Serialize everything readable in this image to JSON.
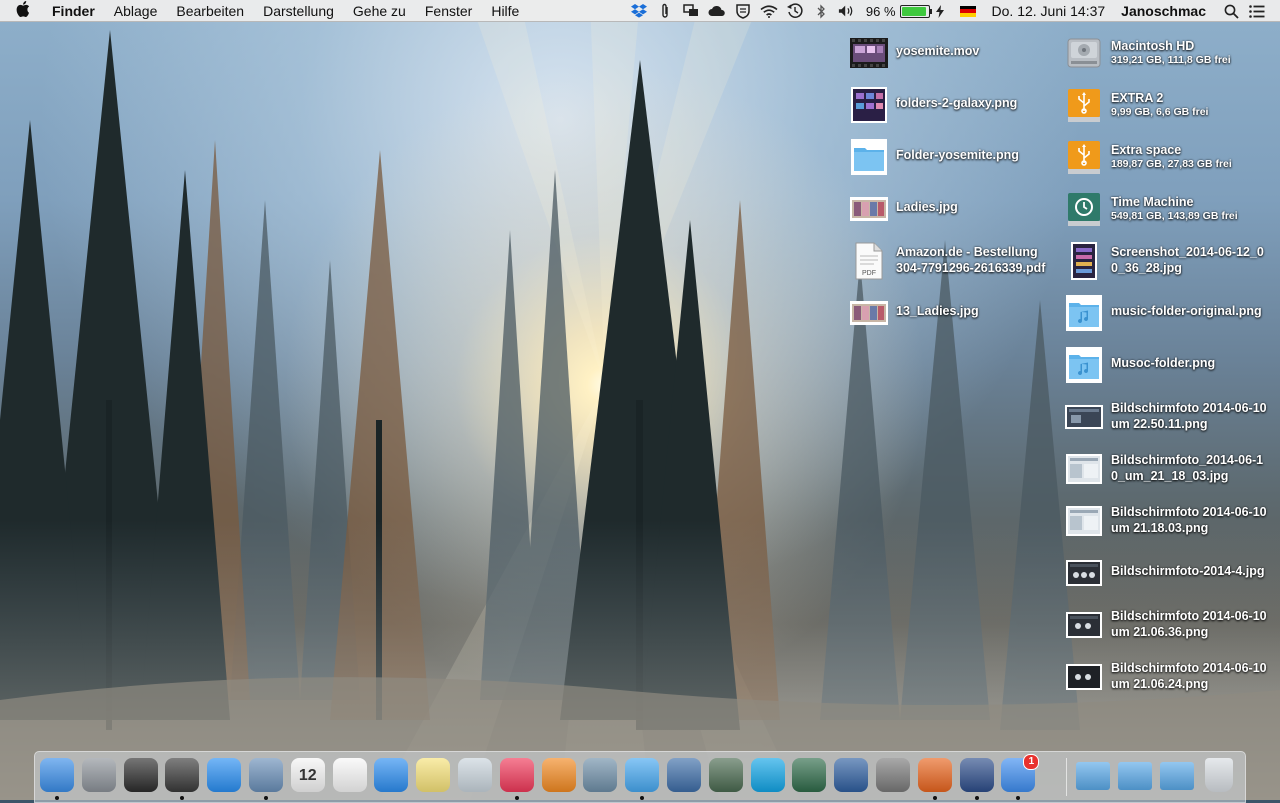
{
  "menubar": {
    "app_name": "Finder",
    "menus": [
      "Ablage",
      "Bearbeiten",
      "Darstellung",
      "Gehe zu",
      "Fenster",
      "Hilfe"
    ],
    "battery_percent": "96 %",
    "battery_level": 0.96,
    "clock": "Do. 12. Juni  14:37",
    "username": "Janoschmac"
  },
  "desktop_left": [
    {
      "name": "yosemite.mov",
      "icon": "movie-thumbnail-icon"
    },
    {
      "name": "folders-2-galaxy.png",
      "icon": "image-thumbnail-icon"
    },
    {
      "name": "Folder-yosemite.png",
      "icon": "folder-icon"
    },
    {
      "name": "Ladies.jpg",
      "icon": "image-thumbnail-icon"
    },
    {
      "name": "Amazon.de - Bestellung",
      "sub": "304-7791296-2616339.pdf",
      "icon": "pdf-document-icon"
    },
    {
      "name": "13_Ladies.jpg",
      "icon": "image-thumbnail-icon"
    }
  ],
  "desktop_right": [
    {
      "name": "Macintosh HD",
      "sub": "319,21 GB, 111,8 GB frei",
      "icon": "hard-drive-icon"
    },
    {
      "name": "EXTRA 2",
      "sub": "9,99 GB, 6,6 GB frei",
      "icon": "usb-drive-icon"
    },
    {
      "name": "Extra space",
      "sub": "189,87 GB, 27,83 GB frei",
      "icon": "usb-drive-icon"
    },
    {
      "name": "Time Machine",
      "sub": "549,81 GB, 143,89 GB frei",
      "icon": "time-machine-drive-icon"
    },
    {
      "name": "Screenshot_2014-06-12_0",
      "sub2": "0_36_28.jpg",
      "icon": "image-thumbnail-icon"
    },
    {
      "name": "music-folder-original.png",
      "icon": "music-folder-icon"
    },
    {
      "name": "Musoc-folder.png",
      "icon": "music-folder-icon"
    },
    {
      "name": "Bildschirmfoto 2014-06-10",
      "sub2": "um 22.50.11.png",
      "icon": "screenshot-thumbnail-icon"
    },
    {
      "name": "Bildschirmfoto_2014-06-1",
      "sub2": "0_um_21_18_03.jpg",
      "icon": "screenshot-thumbnail-icon"
    },
    {
      "name": "Bildschirmfoto 2014-06-10",
      "sub2": "um 21.18.03.png",
      "icon": "screenshot-thumbnail-icon"
    },
    {
      "name": "Bildschirmfoto-2014-4.jpg",
      "icon": "screenshot-thumbnail-icon"
    },
    {
      "name": "Bildschirmfoto 2014-06-10",
      "sub2": "um 21.06.36.png",
      "icon": "screenshot-thumbnail-icon"
    },
    {
      "name": "Bildschirmfoto 2014-06-10",
      "sub2": "um 21.06.24.png",
      "icon": "screenshot-thumbnail-icon"
    }
  ],
  "dock": {
    "apps": [
      {
        "icon": "finder-icon",
        "color": "#3b8ee8",
        "running": true
      },
      {
        "icon": "launchpad-icon",
        "color": "#8c9299",
        "running": false
      },
      {
        "icon": "mission-control-icon",
        "color": "#2c2c2c",
        "running": false
      },
      {
        "icon": "dashboard-icon",
        "color": "#3a3a3a",
        "running": true
      },
      {
        "icon": "app-store-icon",
        "color": "#2a8ff2",
        "running": false
      },
      {
        "icon": "mail-icon",
        "color": "#6a8fb8",
        "running": true
      },
      {
        "icon": "calendar-icon",
        "color": "#f4f4f4",
        "running": false,
        "label": "12"
      },
      {
        "icon": "reminders-icon",
        "color": "#f7f7f7",
        "running": false
      },
      {
        "icon": "safari-icon",
        "color": "#2d8ef0",
        "running": false
      },
      {
        "icon": "notes-icon",
        "color": "#f6e27a",
        "running": false
      },
      {
        "icon": "preview-icon",
        "color": "#c9d4dc",
        "running": false
      },
      {
        "icon": "itunes-icon",
        "color": "#f0395a",
        "running": true
      },
      {
        "icon": "ibooks-icon",
        "color": "#f28a22",
        "running": false
      },
      {
        "icon": "image-capture-icon",
        "color": "#6f8fa8",
        "running": false
      },
      {
        "icon": "messages-icon",
        "color": "#47a8f0",
        "running": true
      },
      {
        "icon": "quicktime-icon",
        "color": "#3e6ea8",
        "running": false
      },
      {
        "icon": "photo-booth-icon",
        "color": "#4a6a50",
        "running": false
      },
      {
        "icon": "skype-icon",
        "color": "#12a5e6",
        "running": false
      },
      {
        "icon": "time-machine-icon",
        "color": "#2f6b4a",
        "running": false
      },
      {
        "icon": "iphoto-icon",
        "color": "#2f5fa0",
        "running": false
      },
      {
        "icon": "system-preferences-icon",
        "color": "#7a7a7a",
        "running": false
      },
      {
        "icon": "firefox-icon",
        "color": "#e8651f",
        "running": true
      },
      {
        "icon": "camino-icon",
        "color": "#2d4d8a",
        "running": true
      },
      {
        "icon": "downloads-icon",
        "color": "#3f8ef0",
        "running": true,
        "badge": "1"
      }
    ],
    "stacks": [
      {
        "icon": "applications-folder-icon",
        "color": "#5aa9e8"
      },
      {
        "icon": "documents-folder-icon",
        "color": "#5aa9e8"
      },
      {
        "icon": "downloads-folder-icon",
        "color": "#5aa9e8"
      },
      {
        "icon": "trash-icon",
        "color": "#d8dde2"
      }
    ]
  }
}
